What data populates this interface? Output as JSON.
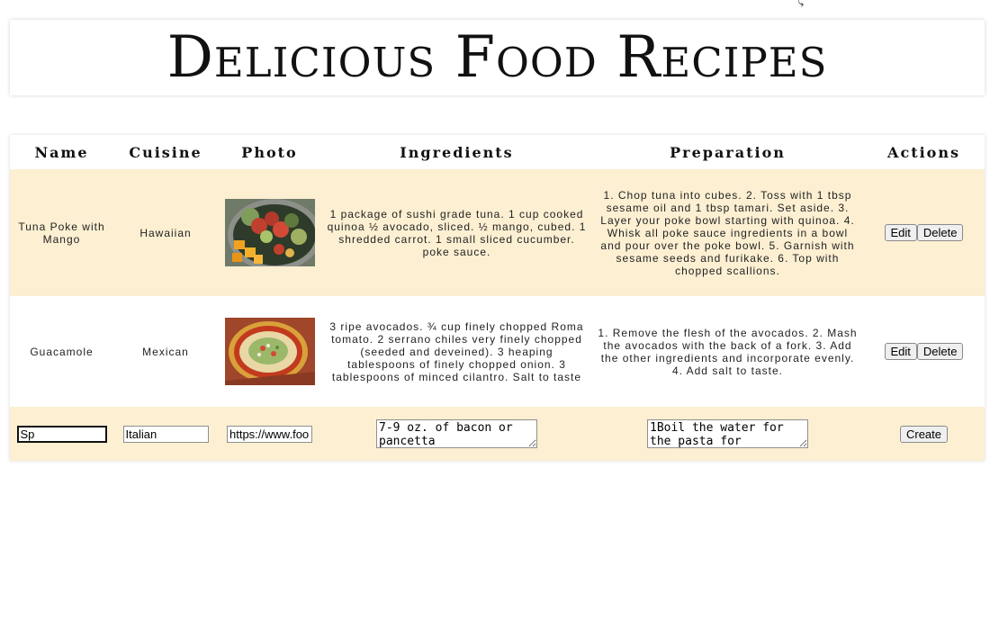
{
  "header": {
    "title": "Delicious Food Recipes"
  },
  "table": {
    "columns": [
      "Name",
      "Cuisine",
      "Photo",
      "Ingredients",
      "Preparation",
      "Actions"
    ],
    "rows": [
      {
        "name": "Tuna Poke with Mango",
        "cuisine": "Hawaiian",
        "photo_alt": "Tuna poke bowl with mango",
        "ingredients": "1 package of sushi grade tuna. 1 cup cooked quinoa ½ avocado, sliced. ½ mango, cubed. 1 shredded carrot. 1 small sliced cucumber. poke sauce.",
        "preparation": "1. Chop tuna into cubes. 2. Toss with 1 tbsp sesame oil and 1 tbsp tamari. Set aside. 3. Layer your poke bowl starting with quinoa. 4. Whisk all poke sauce ingredients in a bowl and pour over the poke bowl. 5. Garnish with sesame seeds and furikake. 6. Top with chopped scallions.",
        "edit_label": "Edit",
        "delete_label": "Delete"
      },
      {
        "name": "Guacamole",
        "cuisine": "Mexican",
        "photo_alt": "Guacamole on a decorative plate",
        "ingredients": "3 ripe avocados. ¾ cup finely chopped Roma tomato. 2 serrano chiles very finely chopped (seeded and deveined). 3 heaping tablespoons of finely chopped onion. 3 tablespoons of minced cilantro. Salt to taste",
        "preparation": "1. Remove the flesh of the avocados. 2. Mash the avocados with the back of a fork. 3. Add the other ingredients and incorporate evenly. 4. Add salt to taste.",
        "edit_label": "Edit",
        "delete_label": "Delete"
      }
    ],
    "form": {
      "name_value": "Sp",
      "cuisine_value": "Italian",
      "photo_value": "https://www.foo",
      "ingredients_value": "7-9 oz. of bacon or pancetta",
      "preparation_value": "1Boil the water for the pasta for",
      "create_label": "Create"
    }
  },
  "colors": {
    "row_highlight": "#fcefd2",
    "row_plain": "#ffffff"
  }
}
